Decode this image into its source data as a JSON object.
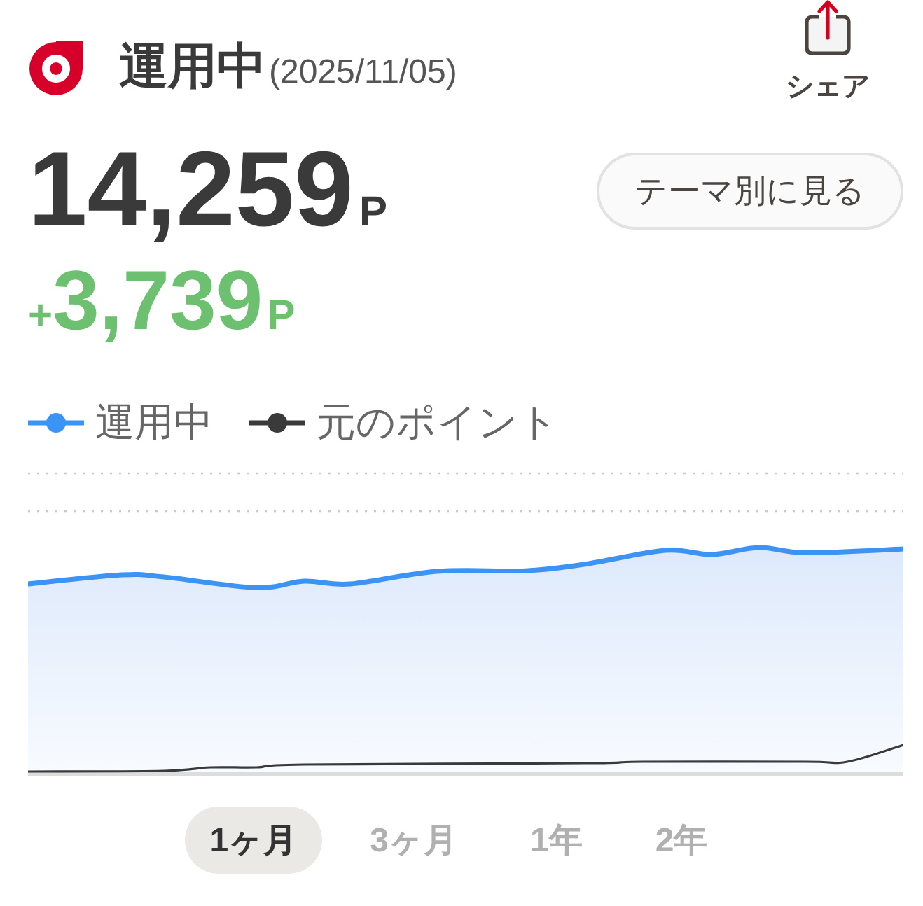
{
  "header": {
    "title": "運用中",
    "date": "(2025/11/05)",
    "share_label": "シェア"
  },
  "balance": {
    "value": "14,259",
    "unit": "P"
  },
  "gain": {
    "sign": "+",
    "value": "3,739",
    "unit": "P"
  },
  "theme_button": "テーマ別に見る",
  "legend": [
    {
      "label": "運用中",
      "color": "#3b94f4"
    },
    {
      "label": "元のポイント",
      "color": "#3a3a3a"
    }
  ],
  "periods": [
    {
      "label": "1ヶ月",
      "selected": true
    },
    {
      "label": "3ヶ月",
      "selected": false
    },
    {
      "label": "1年",
      "selected": false
    },
    {
      "label": "2年",
      "selected": false
    }
  ]
}
